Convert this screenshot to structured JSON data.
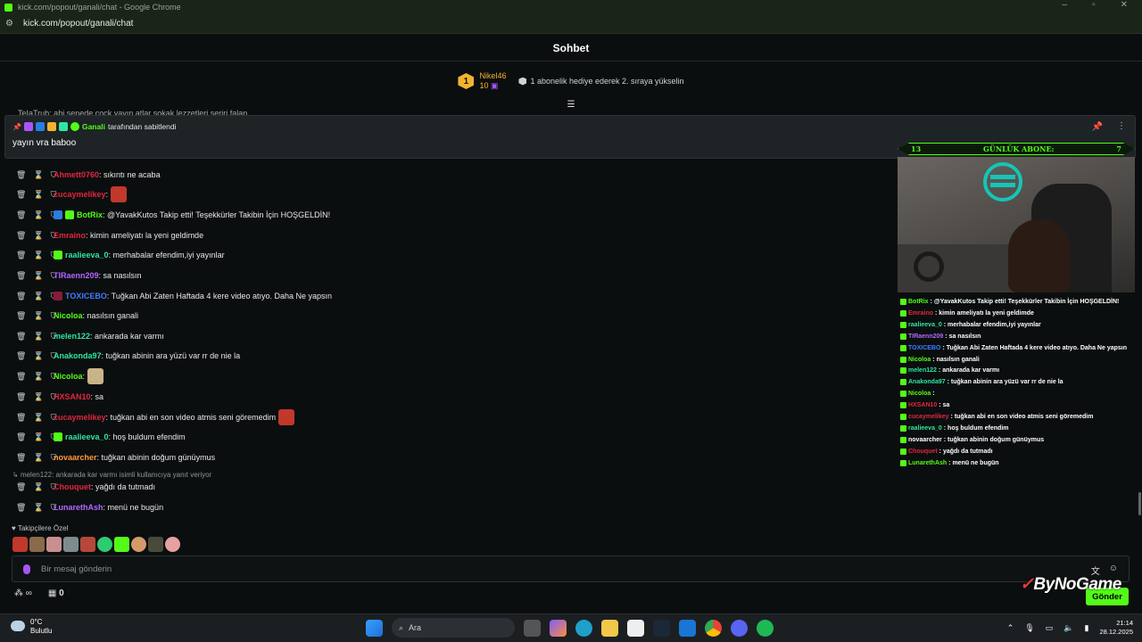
{
  "browser": {
    "window_title": "kick.com/popout/ganali/chat - Google Chrome",
    "url": "kick.com/popout/ganali/chat"
  },
  "header": {
    "title": "Sohbet"
  },
  "leaderboard": {
    "rank": "1",
    "name": "Nikel46",
    "count": "10",
    "hint": "1 abonelik hediye ederek 2. sıraya yükselin"
  },
  "cut_row": "TeIaTrub: abi senede cock yayın atlar sokak lezzetleri seriri falan",
  "pinned": {
    "by_name": "Ganali",
    "by_suffix": "tarafından sabitlendi",
    "message": "yayın vra baboo"
  },
  "messages": [
    {
      "user": "Ahmett0760",
      "color": "#e0263f",
      "text": ": sıkıntı ne acaba",
      "badges": [],
      "emote": ""
    },
    {
      "user": "cucaymelikey",
      "color": "#e0263f",
      "text": ":",
      "badges": [],
      "emote": "#c0392b"
    },
    {
      "user": "BotRix",
      "color": "#53fc18",
      "text": ": @YavakKutos Takip etti! Teşekkürler Takibin İçin HOŞGELDİN!",
      "badges": [
        "#2a7de1",
        "#53fc18"
      ],
      "emote": ""
    },
    {
      "user": "Emraino",
      "color": "#e0263f",
      "text": ": kimin ameliyatı la yeni geldimde",
      "badges": [],
      "emote": ""
    },
    {
      "user": "raalieeva_0",
      "color": "#2ee6a0",
      "text": ": merhabalar efendim,iyi yayınlar",
      "badges": [
        "#53fc18"
      ],
      "emote": ""
    },
    {
      "user": "TIRaenn209",
      "color": "#b267ff",
      "text": ": sa nasılsın",
      "badges": [],
      "emote": ""
    },
    {
      "user": "TOXICEBO",
      "color": "#3f7bff",
      "text": ": Tuğkan Abi Zaten Haftada 4 kere video atıyo. Daha Ne yapsın",
      "badges": [
        "#8b1a3a"
      ],
      "emote": ""
    },
    {
      "user": "Nicoloa",
      "color": "#53fc18",
      "text": ": nasılsın ganali",
      "badges": [],
      "emote": ""
    },
    {
      "user": "melen122",
      "color": "#2ee6a0",
      "text": ": ankarada kar varmı",
      "badges": [],
      "emote": ""
    },
    {
      "user": "Anakonda97",
      "color": "#2ee6a0",
      "text": ": tuğkan abinin ara yüzü var rr de nie la",
      "badges": [],
      "emote": ""
    },
    {
      "user": "Nicoloa",
      "color": "#53fc18",
      "text": ":",
      "badges": [],
      "emote": "#c9b48a"
    },
    {
      "user": "HXSAN10",
      "color": "#e0263f",
      "text": ": sa",
      "badges": [],
      "emote": ""
    },
    {
      "user": "cucaymelikey",
      "color": "#e0263f",
      "text": ": tuğkan abi en son video atmis seni göremedim",
      "badges": [],
      "emote": "#c0392b"
    },
    {
      "user": "raalieeva_0",
      "color": "#2ee6a0",
      "text": ": hoş buldum efendim",
      "badges": [
        "#53fc18"
      ],
      "emote": ""
    },
    {
      "user": "novaarcher",
      "color": "#ff9a3c",
      "text": ": tuğkan abinin doğum günüymus",
      "badges": [],
      "emote": ""
    },
    {
      "user": "Chouquet",
      "color": "#e0263f",
      "text": ": yağdı da tutmadı",
      "badges": [],
      "emote": ""
    },
    {
      "user": "LunarethAsh",
      "color": "#b267ff",
      "text": ": menü ne bugün",
      "badges": [],
      "emote": ""
    }
  ],
  "reply_hint": "melen122: ankarada kar varmı isimli kullanıcıya yanıt veriyor",
  "followers_label": "Takipçilere Özel",
  "input": {
    "placeholder": "Bir mesaj gönderin"
  },
  "bottom": {
    "count": "0",
    "send_label": "Gönder"
  },
  "overlay": {
    "banner_left": "13",
    "banner_title": "GÜNLÜK ABONE:",
    "banner_right": "7",
    "brand": "ByNoGame",
    "chat": [
      {
        "user": "BotRix",
        "color": "#53fc18",
        "text": ": @YavakKutos Takip etti! Teşekkürler Takibin İçin HOŞGELDİN!"
      },
      {
        "user": "Emraino",
        "color": "#e0263f",
        "text": ": kimin ameliyatı la yeni geldimde"
      },
      {
        "user": "raalieeva_0",
        "color": "#2ee6a0",
        "text": ": merhabalar efendim,iyi yayınlar"
      },
      {
        "user": "TIRaenn209",
        "color": "#b267ff",
        "text": ": sa nasılsın"
      },
      {
        "user": "TOXICEBO",
        "color": "#3f7bff",
        "text": ": Tuğkan Abi Zaten Haftada 4 kere video atıyo. Daha Ne yapsın"
      },
      {
        "user": "Nicoloa",
        "color": "#53fc18",
        "text": ": nasılsın ganali"
      },
      {
        "user": "melen122",
        "color": "#2ee6a0",
        "text": ": ankarada kar varmı"
      },
      {
        "user": "Anakonda97",
        "color": "#2ee6a0",
        "text": ": tuğkan abinin ara yüzü var rr de nie la"
      },
      {
        "user": "Nicoloa",
        "color": "#53fc18",
        "text": ":"
      },
      {
        "user": "HXSAN10",
        "color": "#e0263f",
        "text": ": sa"
      },
      {
        "user": "cucaymelikey",
        "color": "#e0263f",
        "text": ": tuğkan abi en son video atmis seni göremedim"
      },
      {
        "user": "raalieeva_0",
        "color": "#2ee6a0",
        "text": ": hoş buldum efendim"
      },
      {
        "user": "novaarcher",
        "color": "#ffffff",
        "text": ": tuğkan abinin doğum günüymus"
      },
      {
        "user": "Chouquet",
        "color": "#e0263f",
        "text": ": yağdı da tutmadı"
      },
      {
        "user": "LunarethAsh",
        "color": "#53fc18",
        "text": ": menü ne bugün"
      }
    ]
  },
  "taskbar": {
    "weather_temp": "0°C",
    "weather_desc": "Bulutlu",
    "search_label": "Ara",
    "time": "21:14",
    "date": "28.12.2025"
  }
}
